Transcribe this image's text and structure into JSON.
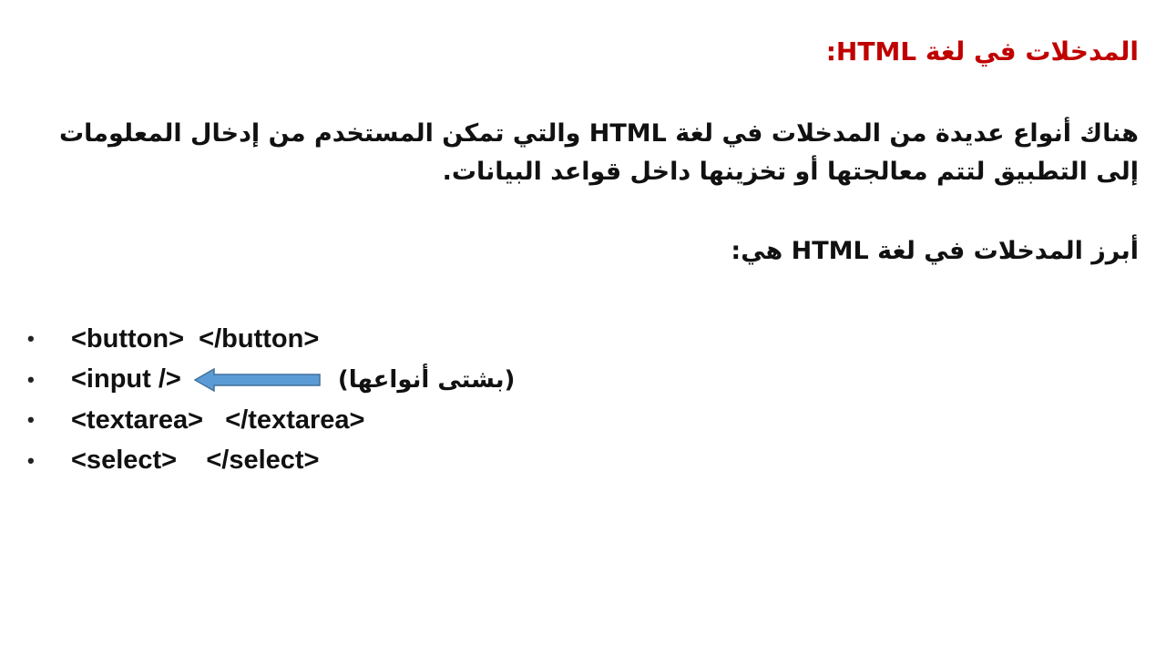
{
  "slide": {
    "title": "المدخلات في لغة HTML:",
    "paragraph": "هناك أنواع عديدة من المدخلات في لغة HTML والتي تمكن المستخدم من إدخال المعلومات إلى التطبيق لتتم معالجتها أو تخزينها داخل قواعد البيانات.",
    "intro": "أبرز المدخلات في لغة HTML هي:",
    "items": [
      {
        "bullet": "•",
        "code": "<button>  </button>"
      },
      {
        "bullet": "•",
        "code": "<input />",
        "note": "(بشتى أنواعها)"
      },
      {
        "bullet": "•",
        "code": "<textarea>   </textarea>"
      },
      {
        "bullet": "•",
        "code": "<select>    </select>"
      }
    ],
    "colors": {
      "title": "#c00000",
      "arrow_fill": "#5b9bd5",
      "arrow_stroke": "#41719c",
      "text": "#111111"
    }
  }
}
